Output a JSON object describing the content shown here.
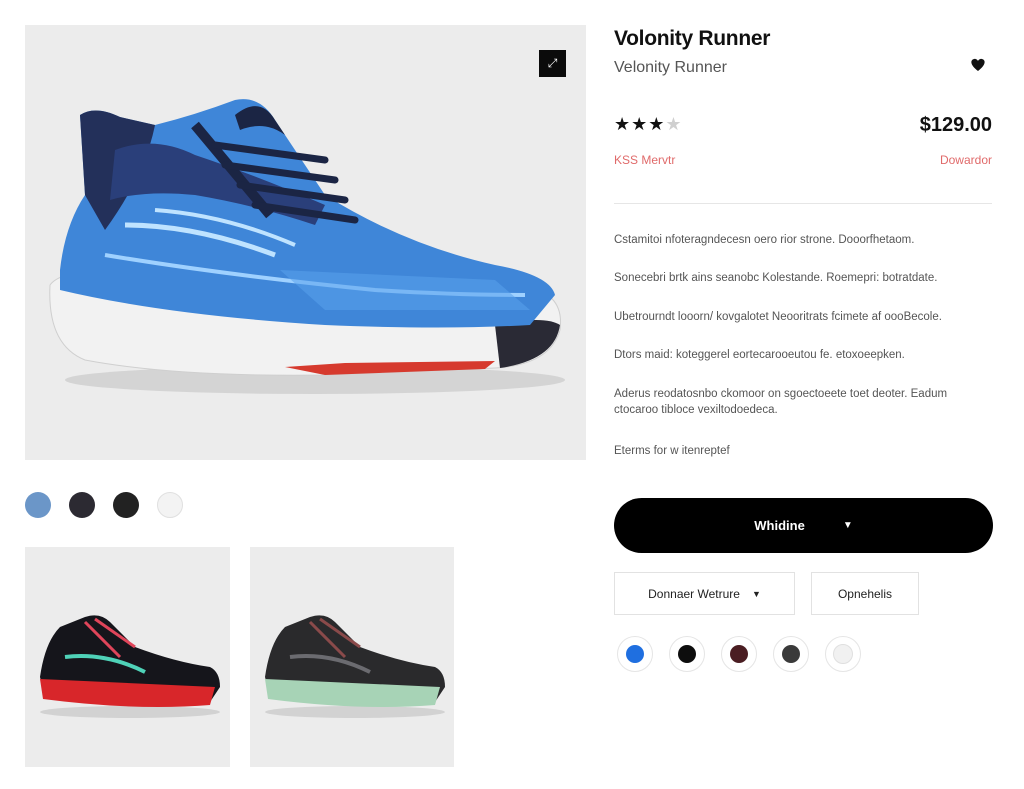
{
  "product": {
    "title": "Volonity Runner",
    "subtitle": "Velonity Runner",
    "rating": 3,
    "rating_max": 5,
    "price": "$129.00",
    "promo_left": "KSS Mervtr",
    "promo_right": "Dowardor",
    "description": [
      "Cstamitoi nfoteragndecesn oero rior strone. Dooorfhetaom.",
      "Sonecebri brtk ains seanobc Kolestande. Roemepri: botratdate.",
      "Ubetrourndt looorn/ kovgalotet Neooritrats fcimete af oooBecole.",
      "Dtors maid: koteggerel eortecarooeutou fe. etoxoeepken.",
      "Aderus reodatosnbo ckomoor on sgoectoeete toet deoter. Eadum ctocaroo tibloce vexiltodoedeca.",
      "Eterms for w itenreptef"
    ]
  },
  "hero": {
    "expand_icon": "expand-icon"
  },
  "swatches": [
    "#6b96c8",
    "#2c2a32",
    "#222222",
    "#f3f3f3"
  ],
  "cta": {
    "label": "Whidine"
  },
  "options": {
    "size_label": "Donnaer Wetrure",
    "secondary_label": "Opnehelis"
  },
  "color_options": [
    "#1f6fe0",
    "#0d0d0d",
    "#4a1d22",
    "#3a3a3a",
    "#f1f1f1"
  ]
}
